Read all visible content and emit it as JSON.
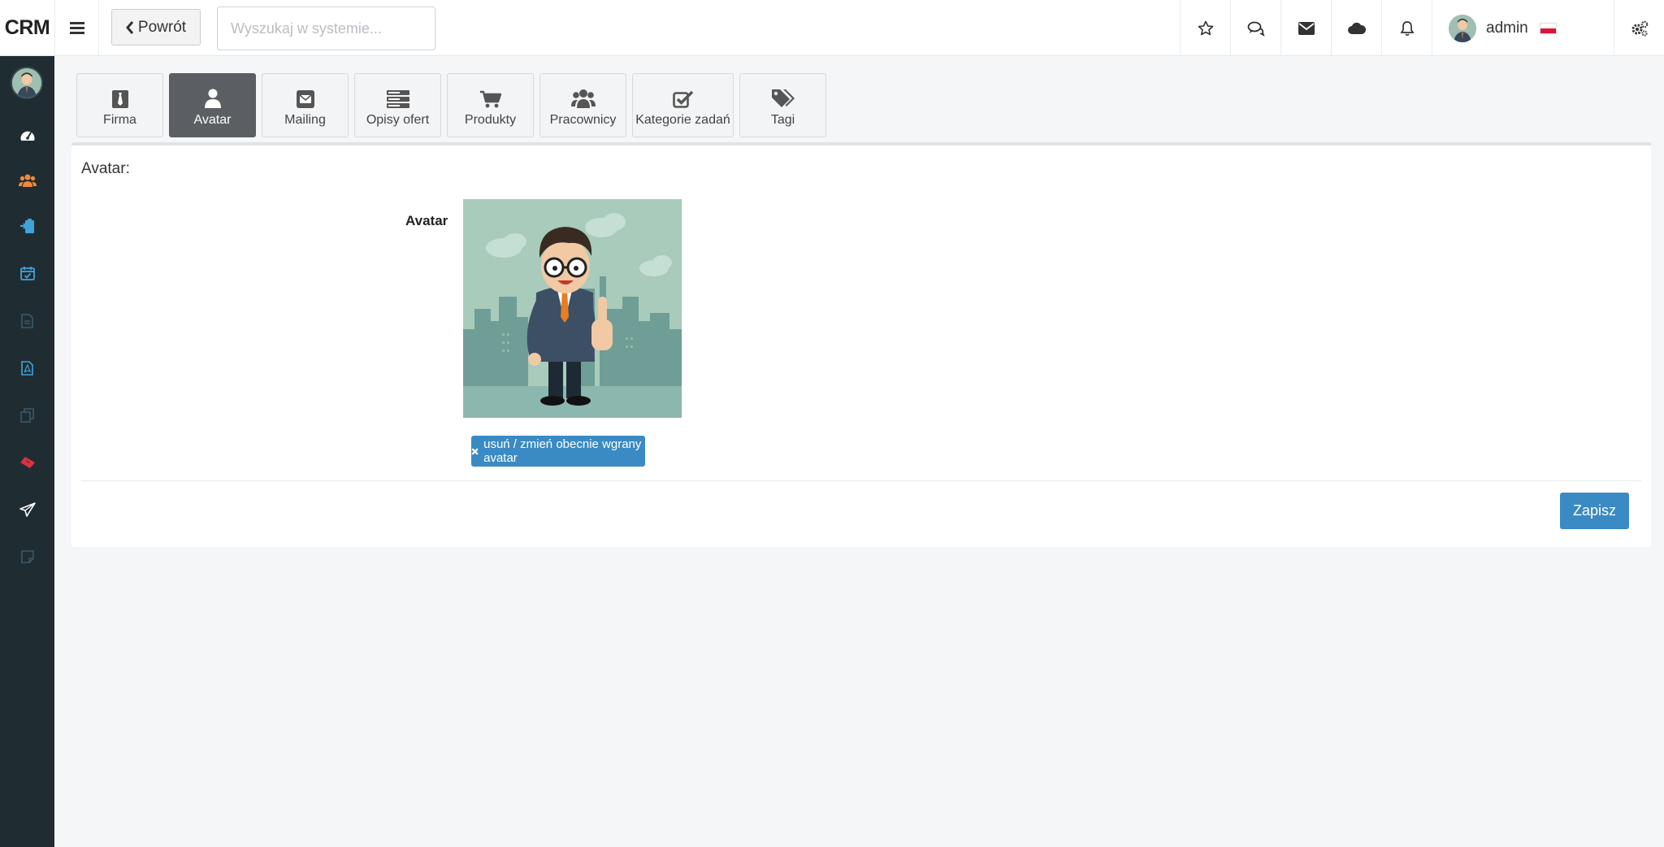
{
  "app": {
    "logo": "CRM"
  },
  "toolbar": {
    "back_label": "Powrót",
    "search_placeholder": "Wyszukaj w systemie..."
  },
  "user": {
    "name": "admin"
  },
  "tabs": [
    {
      "label": "Firma",
      "icon": "tie-icon"
    },
    {
      "label": "Avatar",
      "icon": "user-icon",
      "active": true
    },
    {
      "label": "Mailing",
      "icon": "envelope-icon"
    },
    {
      "label": "Opisy ofert",
      "icon": "server-icon"
    },
    {
      "label": "Produkty",
      "icon": "cart-icon"
    },
    {
      "label": "Pracownicy",
      "icon": "users-icon"
    },
    {
      "label": "Kategorie zadań",
      "icon": "check-square-icon"
    },
    {
      "label": "Tagi",
      "icon": "tags-icon"
    }
  ],
  "panel": {
    "title": "Avatar:",
    "field_label": "Avatar",
    "remove_button": "usuń / zmień obecnie wgrany avatar",
    "save_button": "Zapisz"
  },
  "colors": {
    "sidebar": "#1f2d33",
    "primary": "#3a8ac4",
    "active_tab": "#5b5f63"
  }
}
